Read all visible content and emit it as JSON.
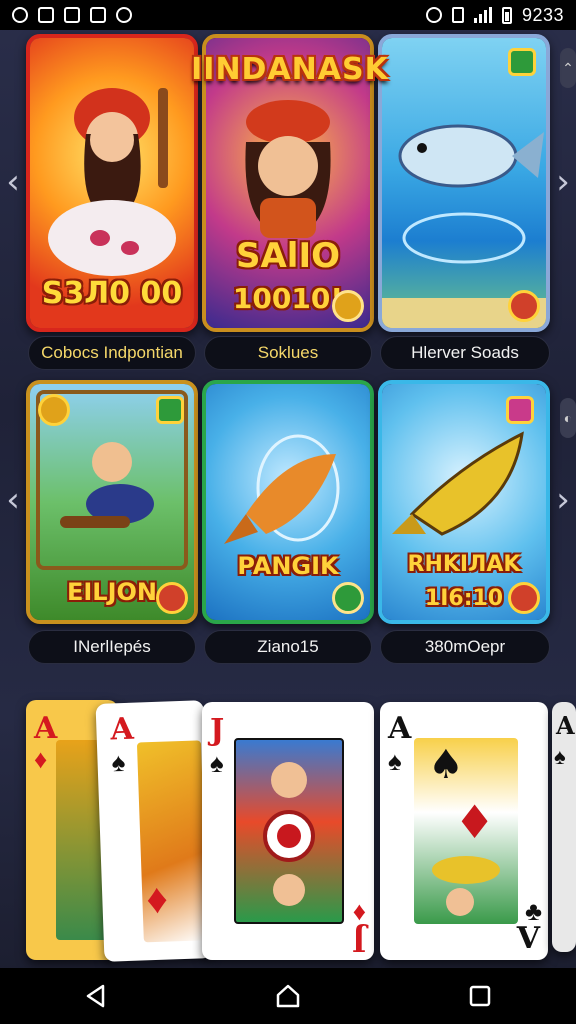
{
  "status_bar": {
    "time": "9233"
  },
  "banner": {
    "title": "IINDANASK"
  },
  "row1": {
    "cards": [
      {
        "art_text": "S3Л0 00"
      },
      {
        "art_text_top": "SAlIO",
        "art_text_bottom": "10010!"
      },
      {
        "art_text": ""
      }
    ],
    "labels": [
      "Cobocs Indpontian",
      "Soklues",
      "Hlerver Soads"
    ]
  },
  "row2": {
    "cards": [
      {
        "art_text": "EILJON"
      },
      {
        "art_text": "PANGIK"
      },
      {
        "art_text_top": "RHKIЛAK",
        "art_text_bottom": "1I6:10"
      }
    ],
    "labels": [
      "INerlIepés",
      "Ziano15",
      "380mOepr"
    ]
  },
  "playing_cards": [
    {
      "rank": "A",
      "suit": "♦"
    },
    {
      "rank": "A",
      "suit": "♠"
    },
    {
      "rank": "J",
      "suit": "♠",
      "rank_bottom": "J",
      "suit_bottom": "♦"
    },
    {
      "rank": "A",
      "suit": "♠",
      "rank_bottom": "V",
      "suit_bottom": "♣"
    },
    {
      "rank": "A",
      "suit": "♠"
    }
  ],
  "colors": {
    "accent_gold": "#ffd23a",
    "title_red": "#b8320e",
    "background": "#1f2238"
  },
  "icons": {
    "back": "back-triangle-icon",
    "home": "home-icon",
    "recents": "recents-square-icon",
    "left": "chevron-left-icon",
    "right": "chevron-right-icon"
  }
}
